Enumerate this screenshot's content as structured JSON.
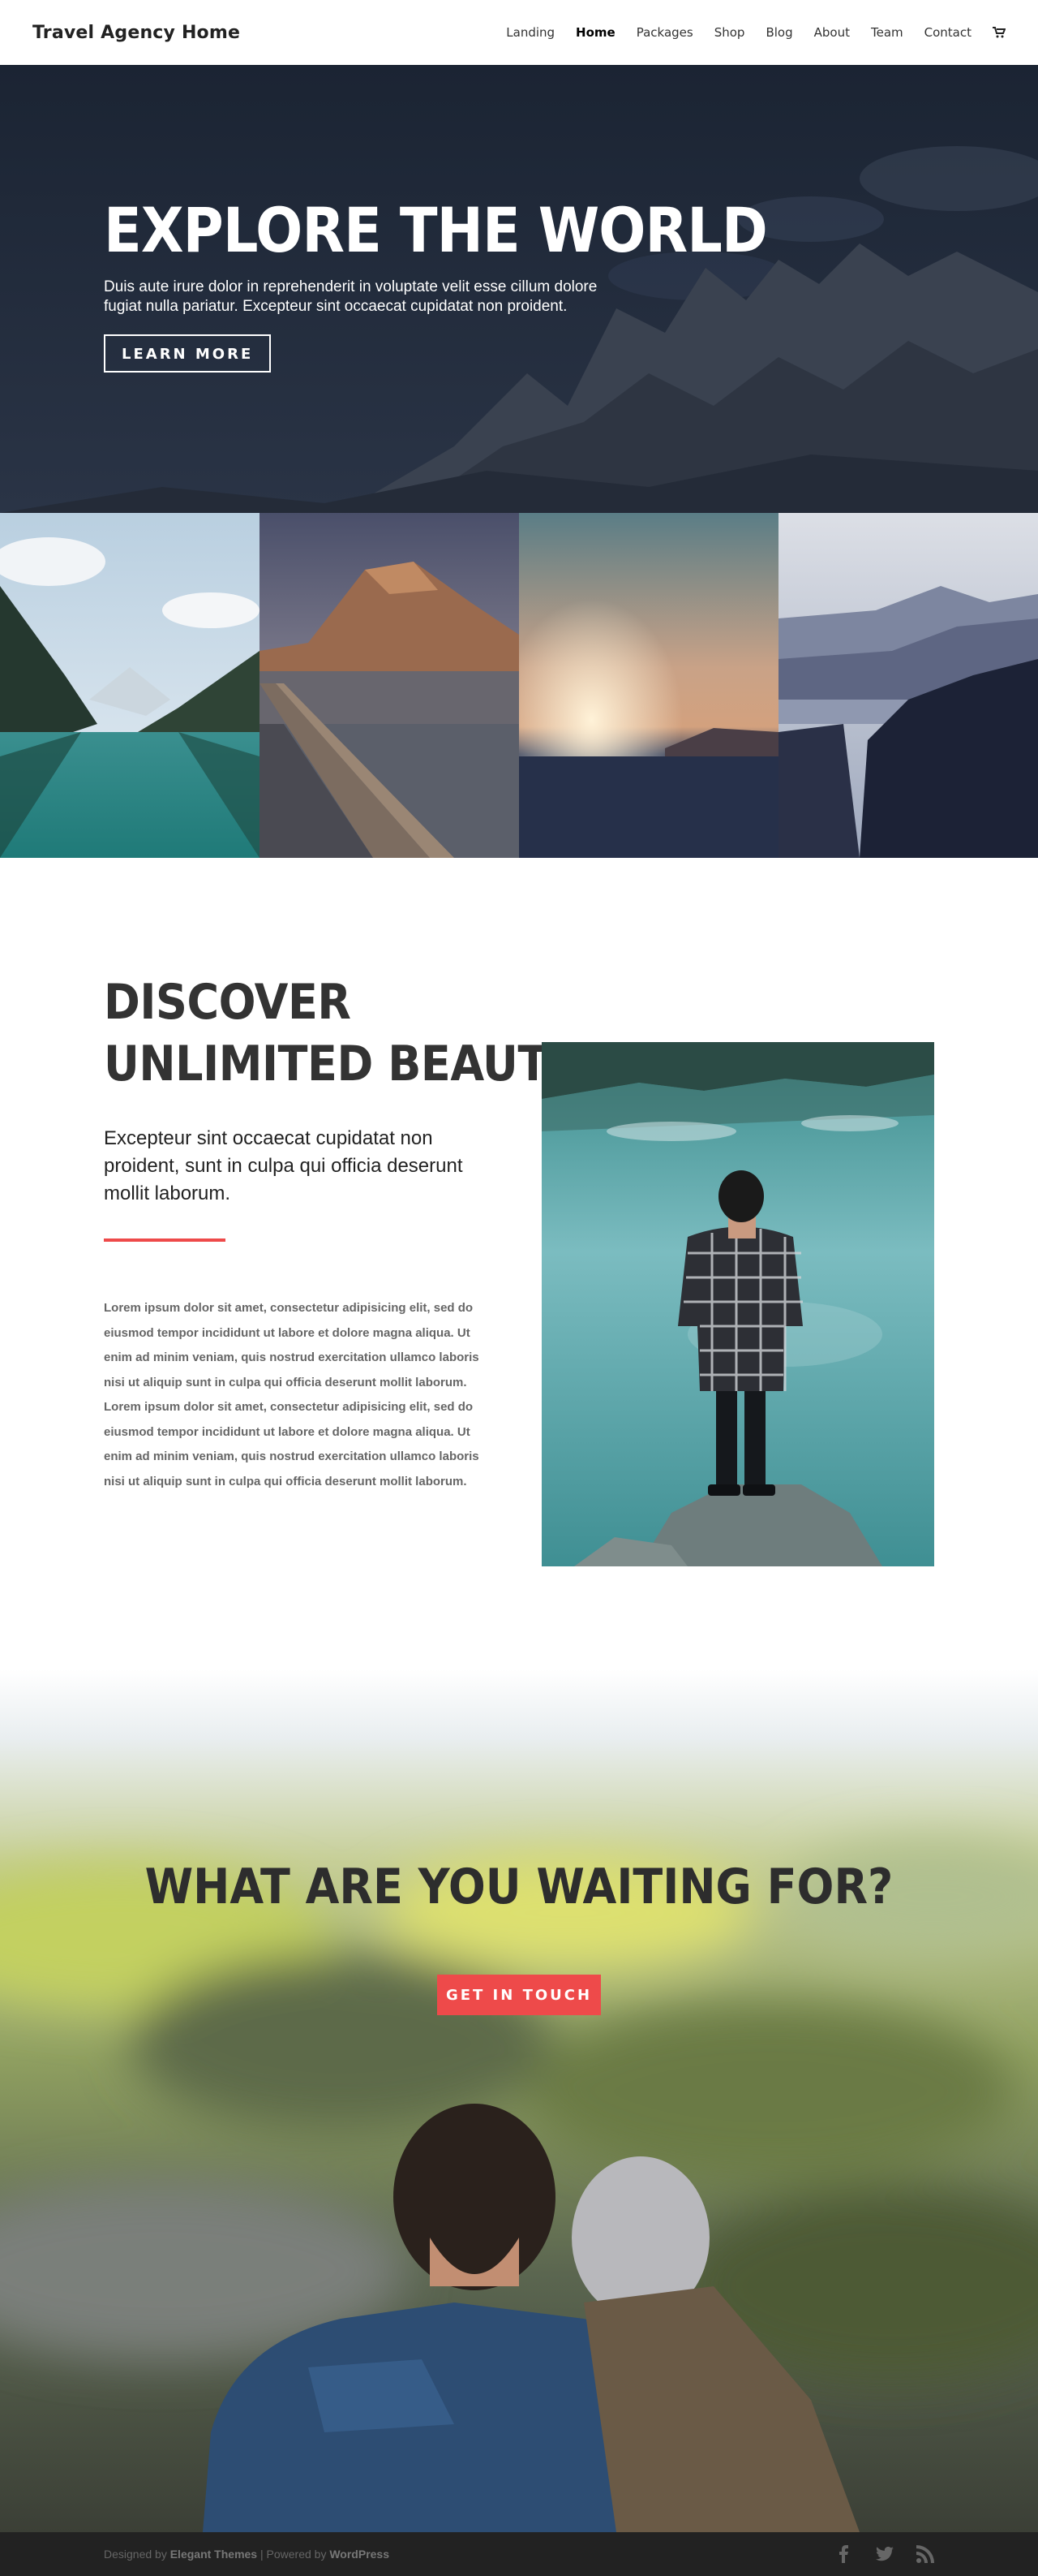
{
  "header": {
    "site_title": "Travel Agency Home",
    "nav": [
      "Landing",
      "Home",
      "Packages",
      "Shop",
      "Blog",
      "About",
      "Team",
      "Contact"
    ],
    "active_nav": "Home",
    "cart_icon": "cart-icon"
  },
  "hero": {
    "title": "EXPLORE THE WORLD",
    "text_line1": "Duis aute irure dolor in reprehenderit in voluptate velit esse cillum dolore",
    "text_line2": "fugiat nulla pariatur. Excepteur sint occaecat cupidatat non proident.",
    "button": "LEARN MORE"
  },
  "discover": {
    "title_line1": "DISCOVER",
    "title_line2": "UNLIMITED BEAUTY",
    "lead": "Excepteur sint occaecat cupidatat non proident, sunt in culpa qui officia deserunt mollit laborum.",
    "body": "Lorem ipsum dolor sit amet, consectetur adipisicing elit, sed do eiusmod tempor incididunt ut labore et dolore magna aliqua. Ut enim ad minim veniam, quis nostrud exercitation ullamco laboris nisi ut aliquip sunt in culpa qui officia deserunt mollit laborum. Lorem ipsum dolor sit amet, consectetur adipisicing elit, sed do eiusmod tempor incididunt ut labore et dolore magna aliqua. Ut enim ad minim veniam, quis nostrud exercitation ullamco laboris nisi ut aliquip sunt in culpa qui officia deserunt mollit laborum."
  },
  "cta": {
    "title": "WHAT ARE YOU WAITING FOR?",
    "button": "GET IN TOUCH"
  },
  "footer": {
    "designed_by": "Designed by",
    "designer": "Elegant Themes",
    "separator": "|",
    "powered_by": "Powered by",
    "platform": "WordPress",
    "social_icons": [
      "facebook-icon",
      "twitter-icon",
      "rss-icon"
    ]
  },
  "colors": {
    "accent": "#ee4a4a",
    "hero_bg": "#1c2535",
    "footer_bg": "#222222"
  }
}
